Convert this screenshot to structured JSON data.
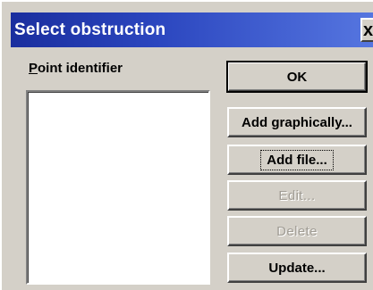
{
  "window": {
    "title": "Select obstruction",
    "close_glyph": "x"
  },
  "list": {
    "label_mnemonic": "P",
    "label_rest": "oint identifier",
    "items": []
  },
  "buttons": {
    "ok": "OK",
    "add_graphically": "Add graphically...",
    "add_file": "Add file...",
    "edit": "Edit...",
    "delete": "Delete",
    "update": "Update..."
  },
  "colors": {
    "face": "#d4d0c8",
    "title_start": "#1a2e9e",
    "title_end": "#5676e0",
    "disabled_text": "#a09c94"
  }
}
